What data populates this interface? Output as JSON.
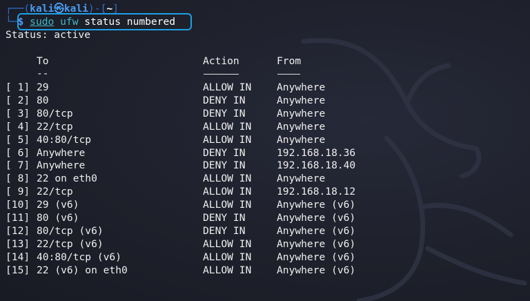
{
  "prompt": {
    "user_host": "kali㉿kali",
    "cwd": "~",
    "dollar": "$"
  },
  "command": {
    "sudo": "sudo",
    "ufw": "ufw",
    "args": "status numbered"
  },
  "status_line": "Status: active",
  "table": {
    "headers": {
      "to": "To",
      "action": "Action",
      "from": "From"
    },
    "to_underline": "--",
    "rows": [
      {
        "num": "[ 1]",
        "to": "29",
        "action": "ALLOW IN",
        "from": "Anywhere"
      },
      {
        "num": "[ 2]",
        "to": "80",
        "action": "DENY IN",
        "from": "Anywhere"
      },
      {
        "num": "[ 3]",
        "to": "80/tcp",
        "action": "DENY IN",
        "from": "Anywhere"
      },
      {
        "num": "[ 4]",
        "to": "22/tcp",
        "action": "ALLOW IN",
        "from": "Anywhere"
      },
      {
        "num": "[ 5]",
        "to": "40:80/tcp",
        "action": "ALLOW IN",
        "from": "Anywhere"
      },
      {
        "num": "[ 6]",
        "to": "Anywhere",
        "action": "DENY IN",
        "from": "192.168.18.36"
      },
      {
        "num": "[ 7]",
        "to": "Anywhere",
        "action": "DENY IN",
        "from": "192.168.18.40"
      },
      {
        "num": "[ 8]",
        "to": "22 on eth0",
        "action": "ALLOW IN",
        "from": "Anywhere"
      },
      {
        "num": "[ 9]",
        "to": "22/tcp",
        "action": "ALLOW IN",
        "from": "192.168.18.12"
      },
      {
        "num": "[10]",
        "to": "29 (v6)",
        "action": "ALLOW IN",
        "from": "Anywhere (v6)"
      },
      {
        "num": "[11]",
        "to": "80 (v6)",
        "action": "DENY IN",
        "from": "Anywhere (v6)"
      },
      {
        "num": "[12]",
        "to": "80/tcp (v6)",
        "action": "DENY IN",
        "from": "Anywhere (v6)"
      },
      {
        "num": "[13]",
        "to": "22/tcp (v6)",
        "action": "ALLOW IN",
        "from": "Anywhere (v6)"
      },
      {
        "num": "[14]",
        "to": "40:80/tcp (v6)",
        "action": "ALLOW IN",
        "from": "Anywhere (v6)"
      },
      {
        "num": "[15]",
        "to": "22 (v6) on eth0",
        "action": "ALLOW IN",
        "from": "Anywhere (v6)"
      }
    ]
  },
  "colors": {
    "background": "#1e202b",
    "prompt_blue": "#4a9cf0",
    "command_cyan": "#3fb9c8",
    "highlight_border": "#1ea0e6",
    "text": "#f0f0f0"
  }
}
